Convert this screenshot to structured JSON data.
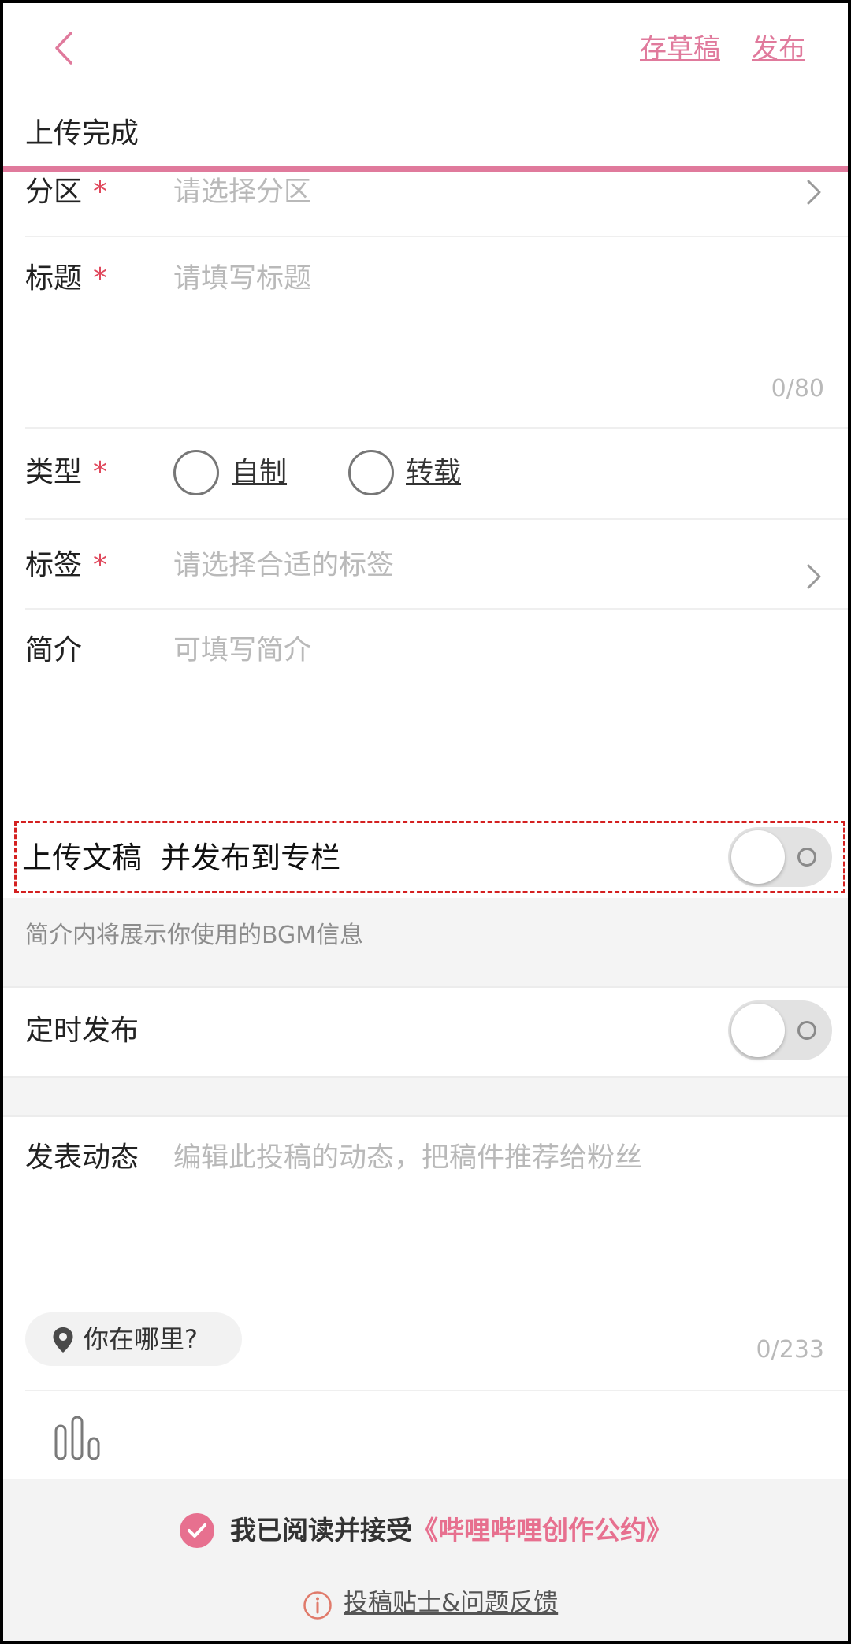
{
  "header": {
    "back_icon": "chevron-left-icon",
    "save_draft": "存草稿",
    "publish": "发布",
    "status": "上传完成",
    "progress": 1.0,
    "accent": "#e07a9c"
  },
  "form": {
    "zone": {
      "label": "分区",
      "required": "*",
      "placeholder": "请选择分区"
    },
    "title": {
      "label": "标题",
      "required": "*",
      "placeholder": "请填写标题",
      "counter": "0/80"
    },
    "type": {
      "label": "类型",
      "required": "*",
      "options": [
        "自制",
        "转载"
      ]
    },
    "tags": {
      "label": "标签",
      "required": "*",
      "placeholder": "请选择合适的标签"
    },
    "intro": {
      "label": "简介",
      "placeholder": "可填写简介"
    }
  },
  "column": {
    "label": "上传文稿  并发布到专栏",
    "enabled": false,
    "highlight": "#d42020"
  },
  "bgm_note": "简介内将展示你使用的BGM信息",
  "schedule": {
    "label": "定时发布",
    "enabled": false
  },
  "dynamic": {
    "label": "发表动态",
    "placeholder": "编辑此投稿的动态，把稿件推荐给粉丝",
    "location_icon": "location-pin-icon",
    "location": "你在哪里?",
    "counter": "0/233",
    "voice_icon": "sound-bars-icon"
  },
  "footer": {
    "agree_prefix": "我已阅读并接受",
    "agree_link": "《哔哩哔哩创作公约》",
    "agreed": true,
    "help_icon": "info-circle-icon",
    "help_link": "投稿贴士&问题反馈",
    "accent": "#e7708f"
  }
}
